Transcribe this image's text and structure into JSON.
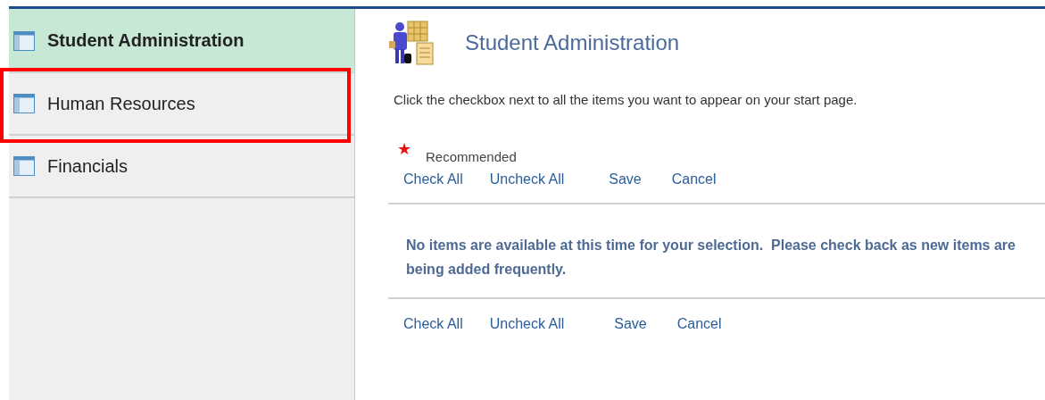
{
  "sidebar": {
    "items": [
      {
        "label": "Student Administration",
        "selected": true,
        "highlighted": false
      },
      {
        "label": "Human Resources",
        "selected": false,
        "highlighted": true
      },
      {
        "label": "Financials",
        "selected": false,
        "highlighted": false
      }
    ]
  },
  "header": {
    "title": "Student Administration"
  },
  "instruction": "Click the checkbox next to all the items you want to appear on your start page.",
  "legend": {
    "star": "★",
    "label": "Recommended"
  },
  "toolbar_top": [
    "Check All",
    "Uncheck All",
    "Save",
    "Cancel"
  ],
  "message": "No items are available at this time for your selection.  Please check back as new items are being added frequently.",
  "toolbar_bottom": [
    "Check All",
    "Uncheck All",
    "Save",
    "Cancel"
  ]
}
